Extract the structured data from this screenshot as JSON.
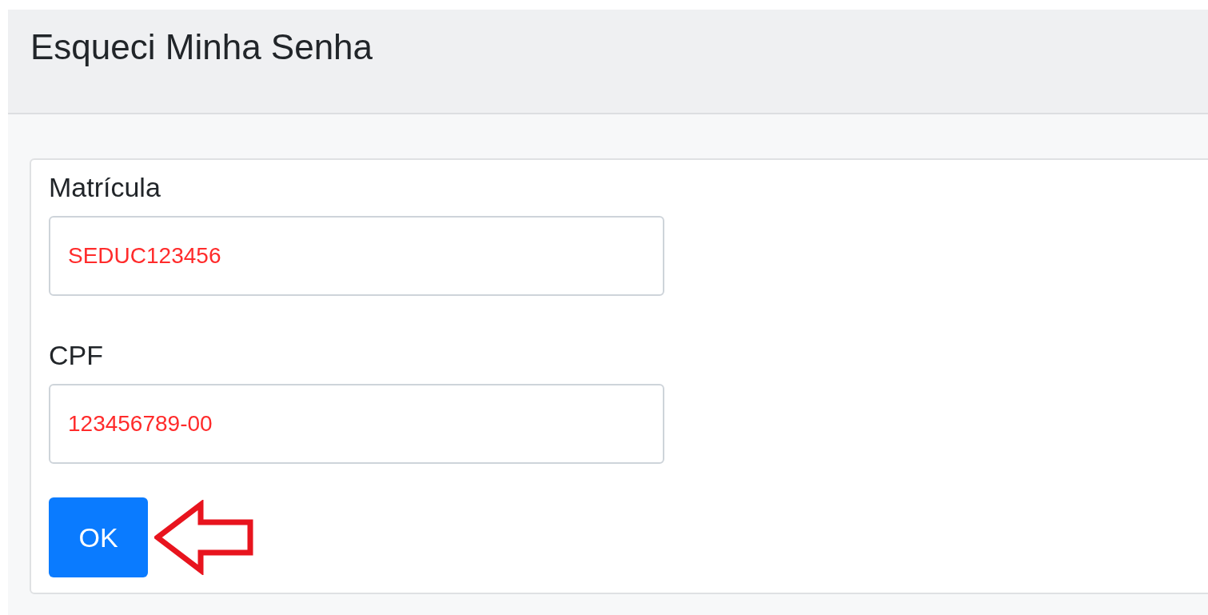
{
  "header": {
    "title": "Esqueci Minha Senha"
  },
  "form": {
    "fields": [
      {
        "label": "Matrícula",
        "value": "SEDUC123456"
      },
      {
        "label": "CPF",
        "value": "123456789-00"
      }
    ],
    "submit": {
      "label": "OK"
    }
  }
}
